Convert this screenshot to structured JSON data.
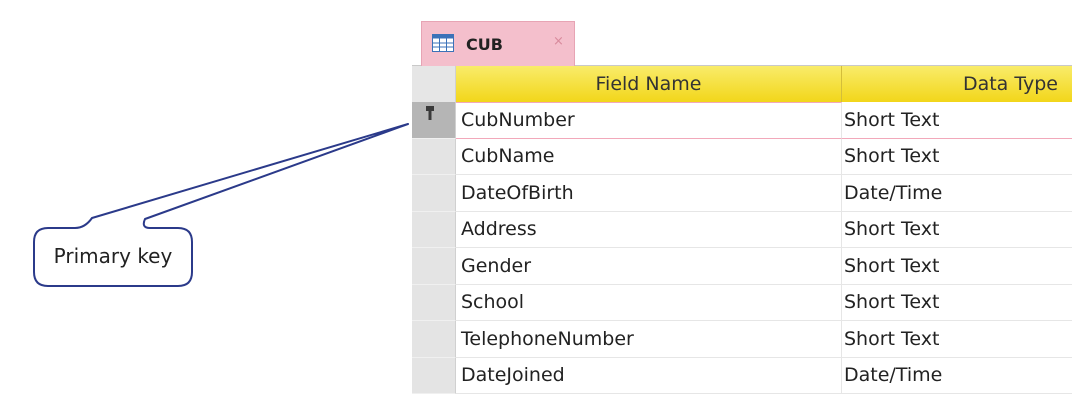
{
  "callout": {
    "label": "Primary key"
  },
  "table": {
    "tab_label": "CUB",
    "close_glyph": "×",
    "icon": "table-icon",
    "columns": {
      "field_name": "Field Name",
      "data_type": "Data Type"
    },
    "selected_row": 0,
    "primary_key_icon": "key-icon",
    "rows": [
      {
        "field_name": "CubNumber",
        "data_type": "Short Text"
      },
      {
        "field_name": "CubName",
        "data_type": "Short Text"
      },
      {
        "field_name": "DateOfBirth",
        "data_type": "Date/Time"
      },
      {
        "field_name": "Address",
        "data_type": "Short Text"
      },
      {
        "field_name": "Gender",
        "data_type": "Short Text"
      },
      {
        "field_name": "School",
        "data_type": "Short Text"
      },
      {
        "field_name": "TelephoneNumber",
        "data_type": "Short Text"
      },
      {
        "field_name": "DateJoined",
        "data_type": "Date/Time"
      }
    ]
  },
  "colors": {
    "header_yellow": "#f5de2e",
    "tab_pink": "#f4bfcc",
    "callout_blue": "#2b3a8a"
  }
}
